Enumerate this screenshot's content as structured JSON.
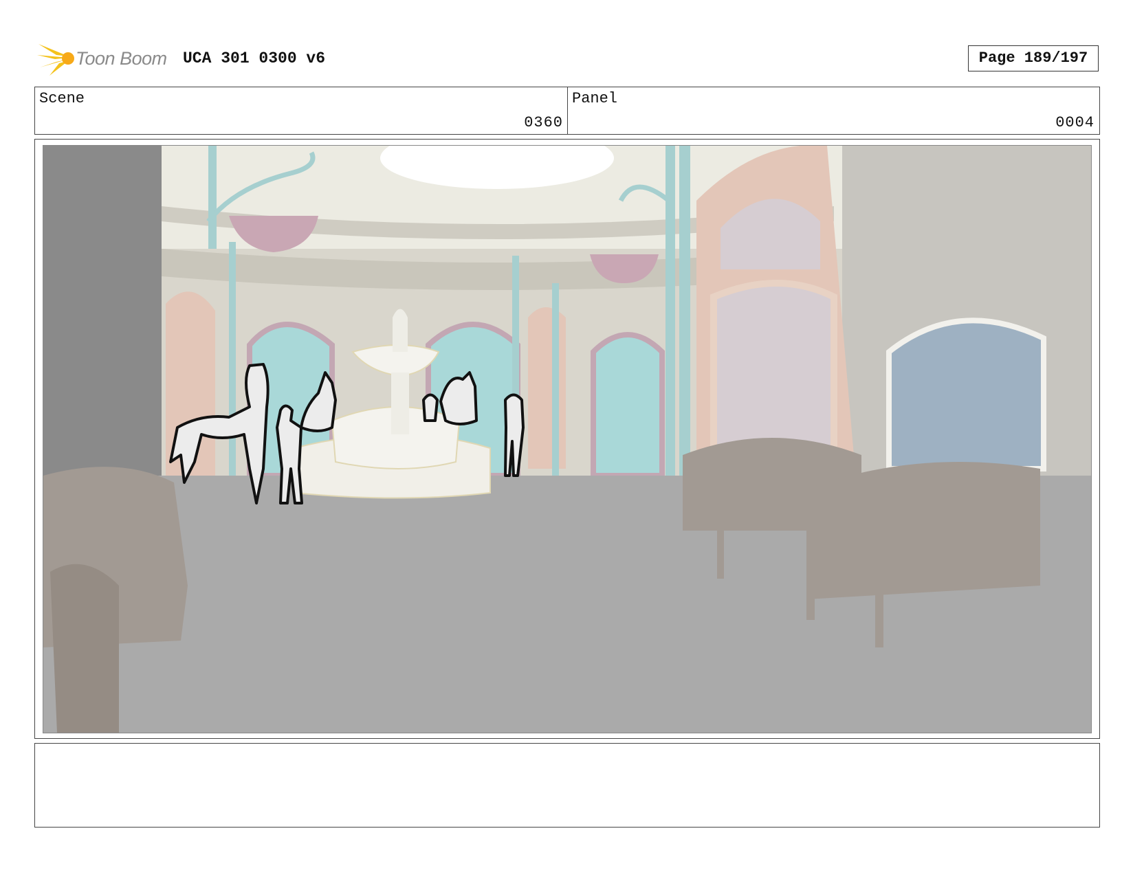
{
  "header": {
    "logo_text": "Toon Boom",
    "title": "UCA 301 0300 v6",
    "page": "Page 189/197"
  },
  "info": {
    "scene_label": "Scene",
    "scene_value": "0360",
    "panel_label": "Panel",
    "panel_value": "0004"
  },
  "panel_image": {
    "icon": "storyboard-frame",
    "colors": {
      "floor": "#aaaaaa",
      "wall": "#d9d6cc",
      "dome": "#ecebe2",
      "teal": "#a6cfcf",
      "pink": "#e3c6b8",
      "planter": "#c9a7b4",
      "bench": "#a29a93"
    }
  },
  "notes": {
    "text": ""
  }
}
